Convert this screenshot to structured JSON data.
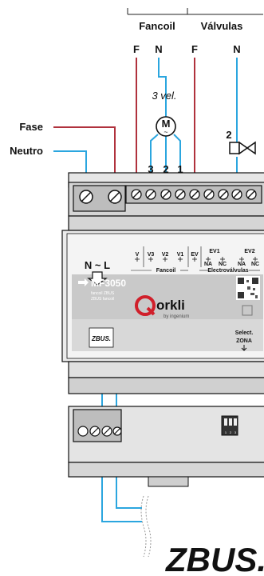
{
  "header": {
    "fancoil": "Fancoil",
    "valvulas": "Válvulas"
  },
  "top_terminals": [
    "F",
    "N",
    "F",
    "N"
  ],
  "motor": {
    "speed_label": "3 vel.",
    "symbol": "M",
    "tilde": "~",
    "speeds": [
      "3",
      "2",
      "1"
    ]
  },
  "valve": {
    "number": "2"
  },
  "supply": {
    "fase": "Fase",
    "neutro": "Neutro"
  },
  "device": {
    "power_label": "N ~ L",
    "fancoil_terms": [
      "V",
      "V3",
      "V2",
      "V1"
    ],
    "ev_term": "EV",
    "ev1": "EV1",
    "ev2": "EV2",
    "na": "NA",
    "nc": "NC",
    "group_fancoil": "Fancoil",
    "group_electro": "Electroválvulas",
    "model": "MF3050",
    "model_sub1": "fancoil ZBUS",
    "model_sub2": "ZBUS fancoil",
    "brand": "orkli",
    "brand_sub": "by ingenium",
    "zbus_badge": "ZBUS.",
    "select_label": "Select.",
    "zona_label": "ZONA",
    "dip_labels": [
      "1",
      "2",
      "3"
    ]
  },
  "bus": {
    "logo": "ZBUS."
  },
  "colors": {
    "blue": "#2ba6df",
    "red": "#b0323d",
    "device_body": "#ebebeb",
    "panel": "#dcdcdc",
    "brand_red": "#d01f2a"
  }
}
